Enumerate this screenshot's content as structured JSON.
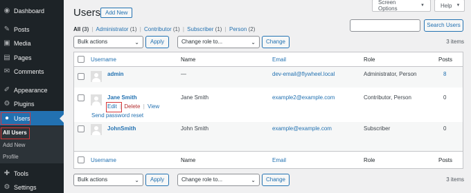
{
  "sidebar": {
    "items": [
      {
        "label": "Dashboard",
        "icon": "dashboard-icon",
        "glyph": "◉"
      },
      {
        "label": "Posts",
        "icon": "pushpin-icon",
        "glyph": "✎"
      },
      {
        "label": "Media",
        "icon": "media-icon",
        "glyph": "▣"
      },
      {
        "label": "Pages",
        "icon": "pages-icon",
        "glyph": "▤"
      },
      {
        "label": "Comments",
        "icon": "comments-icon",
        "glyph": "✉"
      },
      {
        "label": "Appearance",
        "icon": "paintbrush-icon",
        "glyph": "✐"
      },
      {
        "label": "Plugins",
        "icon": "plugin-icon",
        "glyph": "⚙"
      },
      {
        "label": "Users",
        "icon": "users-icon",
        "glyph": "●"
      },
      {
        "label": "Tools",
        "icon": "tools-icon",
        "glyph": "✚"
      },
      {
        "label": "Settings",
        "icon": "settings-icon",
        "glyph": "⚙"
      }
    ],
    "submenu": [
      "All Users",
      "Add New",
      "Profile"
    ]
  },
  "header": {
    "title": "Users",
    "add_new": "Add New",
    "screen_options": "Screen Options",
    "help": "Help"
  },
  "views": [
    {
      "label": "All",
      "count": "(3)"
    },
    {
      "label": "Administrator",
      "count": "(1)"
    },
    {
      "label": "Contributor",
      "count": "(1)"
    },
    {
      "label": "Subscriber",
      "count": "(1)"
    },
    {
      "label": "Person",
      "count": "(2)"
    }
  ],
  "search": {
    "placeholder": "",
    "button": "Search Users"
  },
  "tablenav_top": {
    "bulk": "Bulk actions",
    "apply": "Apply",
    "role": "Change role to...",
    "change": "Change",
    "items": "3 items"
  },
  "tablenav_bottom": {
    "bulk": "Bulk actions",
    "apply": "Apply",
    "role": "Change role to...",
    "change": "Change",
    "items": "3 items"
  },
  "table": {
    "columns": [
      "Username",
      "Name",
      "Email",
      "Role",
      "Posts"
    ],
    "rows": [
      {
        "username": "admin",
        "name": "—",
        "email": "dev-email@flywheel.local",
        "role": "Administrator, Person",
        "posts": "8"
      },
      {
        "username": "Jane Smith",
        "name": "Jane Smith",
        "email": "example2@example.com",
        "role": "Contributor, Person",
        "posts": "0",
        "actions": {
          "edit": "Edit",
          "delete": "Delete",
          "view": "View",
          "reset": "Send password reset"
        }
      },
      {
        "username": "JohnSmith",
        "name": "John Smith",
        "email": "example@example.com",
        "role": "Subscriber",
        "posts": "0"
      }
    ]
  },
  "colors": {
    "sidebar_bg": "#1d2327",
    "accent": "#2271b1",
    "highlight": "#d63638",
    "delete": "#b32d2e"
  }
}
